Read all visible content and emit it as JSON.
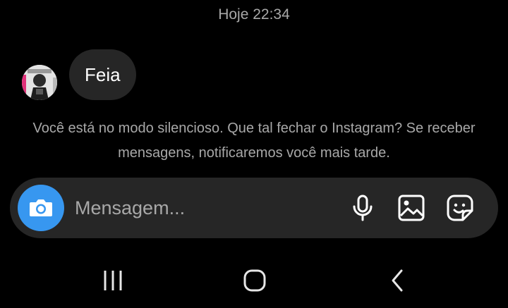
{
  "chat": {
    "timestamp": "Hoje 22:34",
    "messages": [
      {
        "sender": "other",
        "text": "Feia"
      }
    ],
    "quiet_mode_notice": "Você está no modo silencioso. Que tal fechar o Instagram? Se receber mensagens, notificaremos você mais tarde."
  },
  "composer": {
    "placeholder": "Mensagem...",
    "value": "",
    "icons": [
      "camera-icon",
      "microphone-icon",
      "gallery-icon",
      "sticker-icon"
    ]
  },
  "navbar": {
    "icons": [
      "recent-apps-icon",
      "home-icon",
      "back-icon"
    ]
  },
  "colors": {
    "background": "#000000",
    "bubble": "#262626",
    "accent": "#3797f0",
    "muted_text": "#a8a8a8",
    "text": "#ffffff"
  }
}
